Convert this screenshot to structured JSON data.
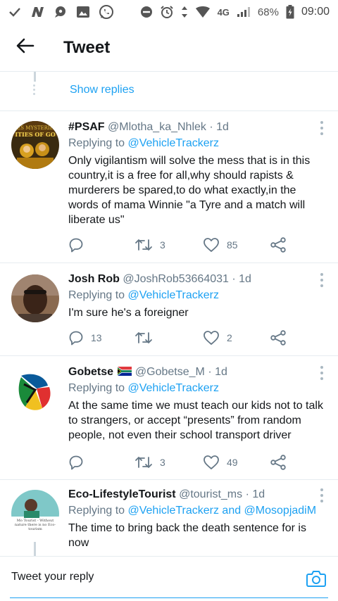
{
  "status_bar": {
    "network": "4G",
    "battery": "68%",
    "time": "09:00"
  },
  "header": {
    "title": "Tweet"
  },
  "thread": {
    "show_replies": "Show replies"
  },
  "tweets": [
    {
      "name": "#PSAF",
      "handle": "@Mlotha_ka_Nhlek",
      "time": "· 1d",
      "replying_label": "Replying to",
      "replying_to": "@VehicleTrackerz",
      "text": "Only vigilantism will solve the mess that is in this country,it is a free for all,why should rapists & murderers be spared,to do what exactly,in the words of mama Winnie \"a Tyre and a match will liberate us\"",
      "replies": "",
      "retweets": "3",
      "likes": "85",
      "avatar_colors": [
        "#3a2a10",
        "#d8a020"
      ]
    },
    {
      "name": "Josh Rob",
      "handle": "@JoshRob53664031",
      "time": "· 1d",
      "replying_label": "Replying to",
      "replying_to": "@VehicleTrackerz",
      "text": "I'm sure he's a foreigner",
      "replies": "13",
      "retweets": "",
      "likes": "2",
      "avatar_colors": [
        "#8a6a50",
        "#3a2a20"
      ]
    },
    {
      "name": "Gobetse",
      "handle": "@Gobetse_M",
      "time": "· 1d",
      "replying_label": "Replying to",
      "replying_to": "@VehicleTrackerz",
      "text": "At the same time we must teach our kids not to talk to strangers, or accept “presents” from random people, not even their school transport driver",
      "replies": "",
      "retweets": "3",
      "likes": "49",
      "avatar_colors": [
        "#0a5a9a",
        "#e03030"
      ]
    },
    {
      "name": "Eco-LifestyleTourist",
      "handle": "@tourist_ms",
      "time": "· 1d",
      "replying_label": "Replying to",
      "replying_to": "@VehicleTrackerz and @MosopjadiM",
      "avatar_caption": "Mo Tourist - Without nature there is no Eco-tourism",
      "text": "The time to bring back the death sentence for is now",
      "avatar_colors": [
        "#7fc8c8",
        "#ffffff"
      ]
    }
  ],
  "reply_bar": {
    "placeholder": "Tweet your reply"
  },
  "colors": {
    "accent": "#1da1f2",
    "muted": "#657786",
    "divider": "#e6ecf0"
  }
}
